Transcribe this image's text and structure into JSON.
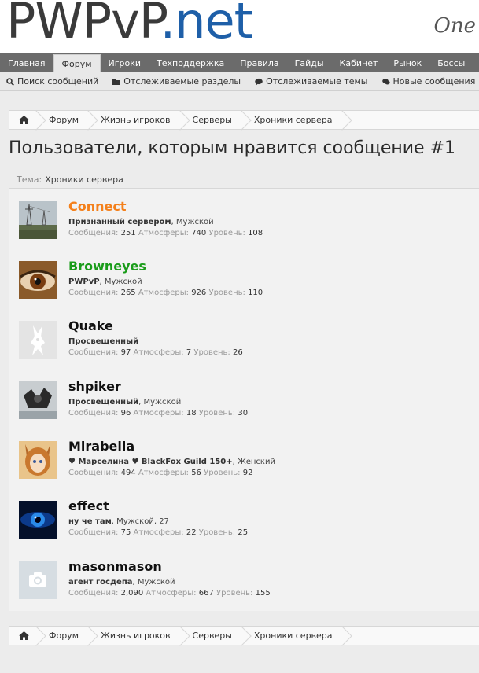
{
  "logo": {
    "part1": "PWPvP",
    "part2": ".net"
  },
  "slogan": "One",
  "mainnav": [
    "Главная",
    "Форум",
    "Игроки",
    "Техподдержка",
    "Правила",
    "Гайды",
    "Кабинет",
    "Рынок",
    "Боссы"
  ],
  "subnav": [
    {
      "label": "Поиск сообщений",
      "icon": "search-icon"
    },
    {
      "label": "Отслеживаемые разделы",
      "icon": "folder-icon"
    },
    {
      "label": "Отслеживаемые темы",
      "icon": "speech-bubble-icon"
    },
    {
      "label": "Новые сообщения",
      "icon": "speech-bubbles-icon"
    }
  ],
  "subnav_count": "1",
  "breadcrumb": [
    "Форум",
    "Жизнь игроков",
    "Серверы",
    "Хроники сервера"
  ],
  "page_title": "Пользователи, которым нравится сообщение #1",
  "theme": {
    "label": "Тема:",
    "value": "Хроники сервера"
  },
  "stat_labels": {
    "messages": "Сообщения:",
    "atmos": "Атмосферы:",
    "level": "Уровень:"
  },
  "users": [
    {
      "name": "Connect",
      "name_color": "#f4801b",
      "title": "Признанный сервером",
      "extra": ", Мужской",
      "messages": "251",
      "atmos": "740",
      "level": "108"
    },
    {
      "name": "Browneyes",
      "name_color": "#1a9c1a",
      "title": "PWPvP",
      "extra": ", Мужской",
      "messages": "265",
      "atmos": "926",
      "level": "110"
    },
    {
      "name": "Quake",
      "name_color": "#111111",
      "title": "Просвещенный",
      "extra": "",
      "messages": "97",
      "atmos": "7",
      "level": "26"
    },
    {
      "name": "shpiker",
      "name_color": "#111111",
      "title": "Просвещенный",
      "extra": ", Мужской",
      "messages": "96",
      "atmos": "18",
      "level": "30"
    },
    {
      "name": "Mirabella",
      "name_color": "#111111",
      "title": "♥ Марселина ♥ BlackFox Guild 150+",
      "extra": ", Женский",
      "messages": "494",
      "atmos": "56",
      "level": "92"
    },
    {
      "name": "effect",
      "name_color": "#111111",
      "title": "ну че там",
      "extra": ", Мужской, 27",
      "messages": "75",
      "atmos": "22",
      "level": "25"
    },
    {
      "name": "masonmason",
      "name_color": "#111111",
      "title": "агент госдепа",
      "extra": ", Мужской",
      "messages": "2,090",
      "atmos": "667",
      "level": "155"
    }
  ]
}
